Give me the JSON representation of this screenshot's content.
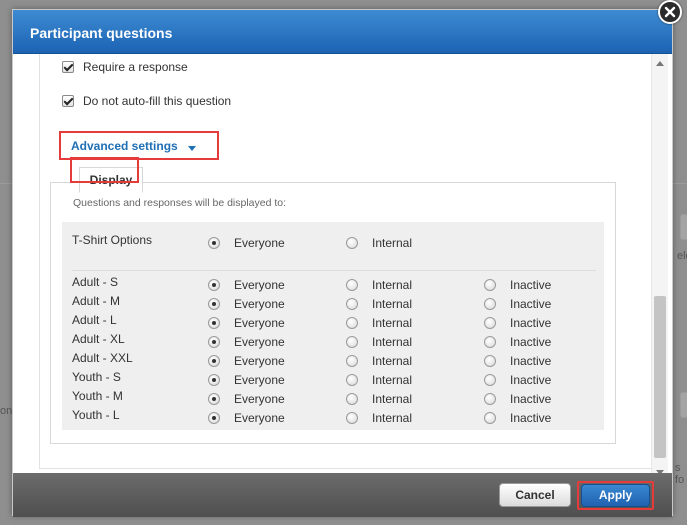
{
  "background": {
    "left_fragment": "on",
    "right_fragment_1": "ele",
    "right_fragment_2": "s fo"
  },
  "dialog": {
    "title": "Participant questions",
    "close_icon": "close-icon"
  },
  "checkboxes": [
    {
      "label": "Require a response",
      "checked": true
    },
    {
      "label": "Do not auto-fill this question",
      "checked": true
    }
  ],
  "advanced_settings": {
    "label": "Advanced settings",
    "icon": "chevron-down-icon"
  },
  "display_tab": {
    "label": "Display",
    "description": "Questions and responses will be displayed to:"
  },
  "question_row": {
    "label": "T-Shirt Options",
    "options": [
      {
        "label": "Everyone",
        "selected": true
      },
      {
        "label": "Internal",
        "selected": false
      }
    ]
  },
  "response_rows": [
    {
      "label": "Adult - S",
      "options": [
        {
          "label": "Everyone",
          "selected": true
        },
        {
          "label": "Internal",
          "selected": false
        },
        {
          "label": "Inactive",
          "selected": false
        }
      ]
    },
    {
      "label": "Adult - M",
      "options": [
        {
          "label": "Everyone",
          "selected": true
        },
        {
          "label": "Internal",
          "selected": false
        },
        {
          "label": "Inactive",
          "selected": false
        }
      ]
    },
    {
      "label": "Adult - L",
      "options": [
        {
          "label": "Everyone",
          "selected": true
        },
        {
          "label": "Internal",
          "selected": false
        },
        {
          "label": "Inactive",
          "selected": false
        }
      ]
    },
    {
      "label": "Adult - XL",
      "options": [
        {
          "label": "Everyone",
          "selected": true
        },
        {
          "label": "Internal",
          "selected": false
        },
        {
          "label": "Inactive",
          "selected": false
        }
      ]
    },
    {
      "label": "Adult - XXL",
      "options": [
        {
          "label": "Everyone",
          "selected": true
        },
        {
          "label": "Internal",
          "selected": false
        },
        {
          "label": "Inactive",
          "selected": false
        }
      ]
    },
    {
      "label": "Youth - S",
      "options": [
        {
          "label": "Everyone",
          "selected": true
        },
        {
          "label": "Internal",
          "selected": false
        },
        {
          "label": "Inactive",
          "selected": false
        }
      ]
    },
    {
      "label": "Youth - M",
      "options": [
        {
          "label": "Everyone",
          "selected": true
        },
        {
          "label": "Internal",
          "selected": false
        },
        {
          "label": "Inactive",
          "selected": false
        }
      ]
    },
    {
      "label": "Youth - L",
      "options": [
        {
          "label": "Everyone",
          "selected": true
        },
        {
          "label": "Internal",
          "selected": false
        },
        {
          "label": "Inactive",
          "selected": false
        }
      ]
    }
  ],
  "footer": {
    "cancel_label": "Cancel",
    "apply_label": "Apply"
  },
  "colors": {
    "accent": "#1f6fb5",
    "highlight": "#e53b3b",
    "title_bar": "#2a74c4"
  }
}
